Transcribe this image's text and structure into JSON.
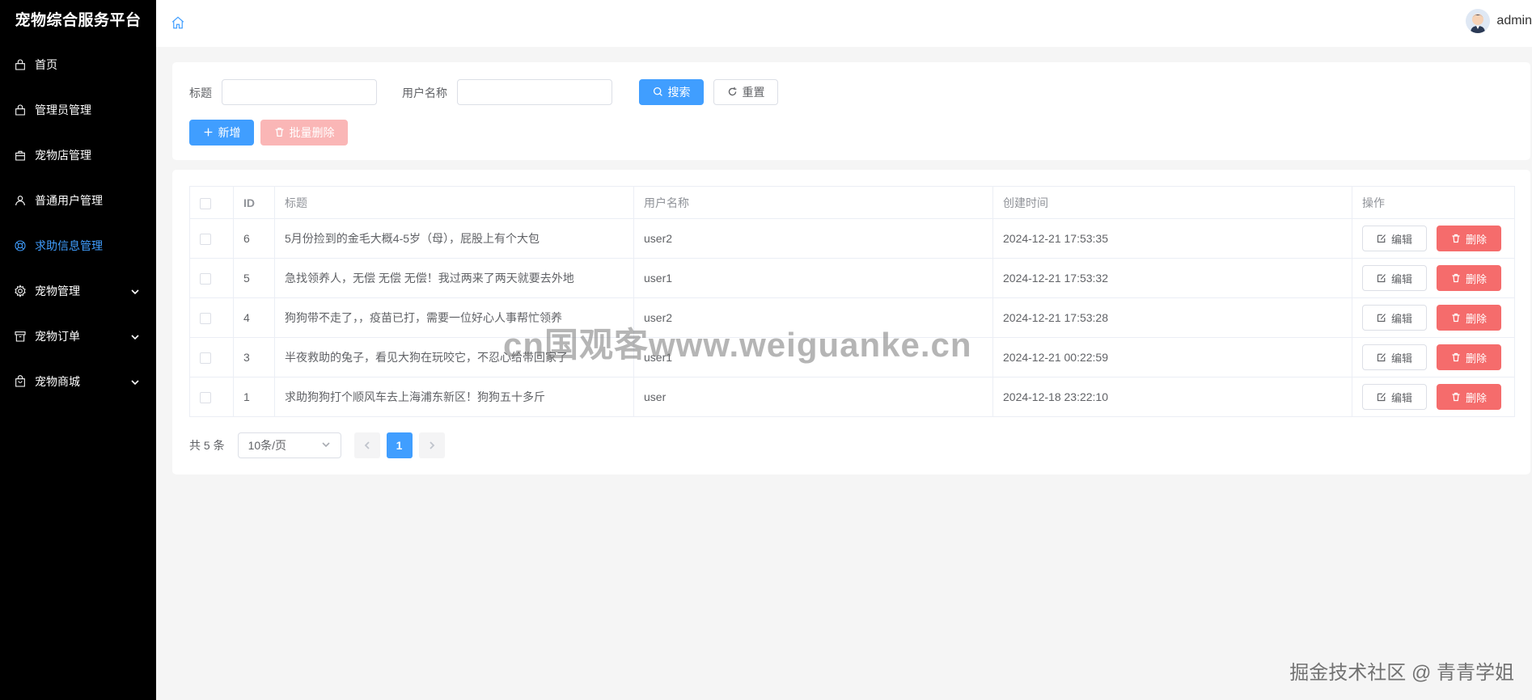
{
  "sidebar": {
    "brand": "宠物综合服务平台",
    "items": [
      {
        "label": "首页",
        "icon": "lock-icon",
        "active": false,
        "expandable": false
      },
      {
        "label": "管理员管理",
        "icon": "lock-icon",
        "active": false,
        "expandable": false
      },
      {
        "label": "宠物店管理",
        "icon": "shop-bag-icon",
        "active": false,
        "expandable": false
      },
      {
        "label": "普通用户管理",
        "icon": "user-icon",
        "active": false,
        "expandable": false
      },
      {
        "label": "求助信息管理",
        "icon": "lifebuoy-icon",
        "active": true,
        "expandable": false
      },
      {
        "label": "宠物管理",
        "icon": "gear-icon",
        "active": false,
        "expandable": true
      },
      {
        "label": "宠物订单",
        "icon": "box-icon",
        "active": false,
        "expandable": true
      },
      {
        "label": "宠物商城",
        "icon": "shopping-bag-icon",
        "active": false,
        "expandable": true
      }
    ],
    "active_color": "#409eff"
  },
  "header": {
    "home_icon": "home-icon",
    "username": "admin"
  },
  "search": {
    "title_label": "标题",
    "title_value": "",
    "username_label": "用户名称",
    "username_value": "",
    "search_button": "搜索",
    "reset_button": "重置",
    "add_button": "新增",
    "batch_delete_button": "批量删除"
  },
  "table": {
    "headers": {
      "id": "ID",
      "title": "标题",
      "username": "用户名称",
      "created": "创建时间",
      "actions": "操作"
    },
    "rows": [
      {
        "id": "6",
        "title": "5月份捡到的金毛大概4-5岁（母），屁股上有个大包",
        "username": "user2",
        "created": "2024-12-21 17:53:35"
      },
      {
        "id": "5",
        "title": "急找领养人，无偿 无偿 无偿！我过两来了两天就要去外地",
        "username": "user1",
        "created": "2024-12-21 17:53:32"
      },
      {
        "id": "4",
        "title": "狗狗带不走了，，疫苗已打，需要一位好心人事帮忙领养",
        "username": "user2",
        "created": "2024-12-21 17:53:28"
      },
      {
        "id": "3",
        "title": "半夜救助的兔子，看见大狗在玩咬它，不忍心给带回家了",
        "username": "user1",
        "created": "2024-12-21 00:22:59"
      },
      {
        "id": "1",
        "title": "求助狗狗打个顺风车去上海浦东新区！狗狗五十多斤",
        "username": "user",
        "created": "2024-12-18 23:22:10"
      }
    ],
    "edit_label": "编辑",
    "delete_label": "删除"
  },
  "pagination": {
    "total_text": "共 5 条",
    "page_size": "10条/页",
    "current_page": "1"
  },
  "watermarks": {
    "center": "cn国观客www.weiguanke.cn",
    "bottom": "掘金技术社区 @ 青青学姐"
  },
  "colors": {
    "primary": "#409eff",
    "danger": "#f56c6c",
    "danger_disabled": "#fab6b6",
    "sidebar_bg": "#000000"
  }
}
